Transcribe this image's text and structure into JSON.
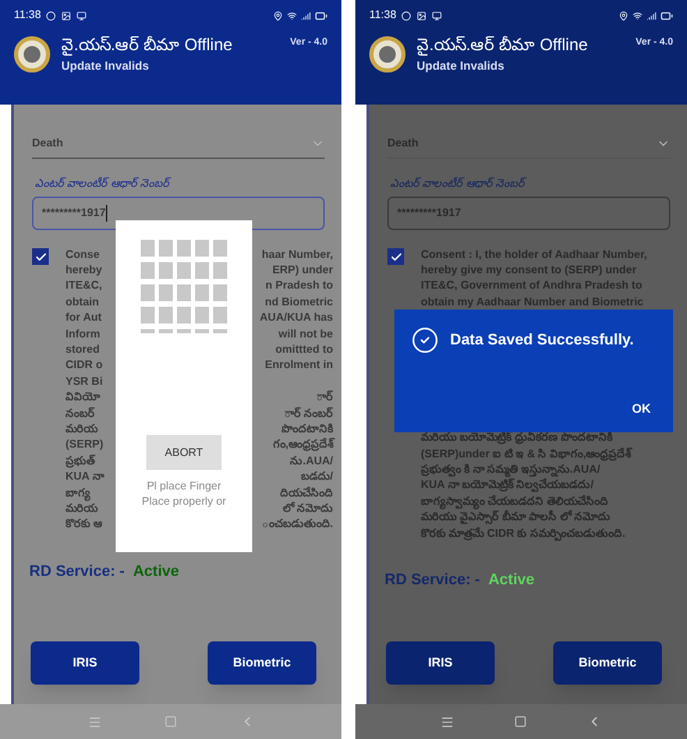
{
  "screens": [
    {
      "status_bar": {
        "time": "11:38"
      },
      "header": {
        "title": "వై.యస్.ఆర్ బీమా Offline",
        "subtitle": "Update Invalids",
        "version": "Ver - 4.0"
      },
      "reason": {
        "value": "Death"
      },
      "aadhaar": {
        "label": "ఎంటర్ వాలంటీర్ ఆధార్ నెంబర్",
        "value": "*********1917",
        "focused": true
      },
      "consent": {
        "checked": true,
        "lines": [
          {
            "left": "Conse",
            "right": "haar Number,"
          },
          {
            "left": "hereby",
            "right": "ERP) under"
          },
          {
            "left": "ITE&C,",
            "right": "n Pradesh to"
          },
          {
            "left": "obtain",
            "right": "nd Biometric"
          },
          {
            "left": "for Aut",
            "right": "AUA/KUA has"
          },
          {
            "left": "Inform",
            "right": "will not be"
          },
          {
            "left": "stored",
            "right": "omittted to"
          },
          {
            "left": "CIDR o",
            "right": "Enrolment in"
          },
          {
            "left": "YSR Bi"
          },
          {
            "left": "వివియో",
            "right": "ార్"
          },
          {
            "left": "నంబర్",
            "right": "ార్ నంబర్"
          },
          {
            "left": "మరియ",
            "right": "పొందటానికి"
          },
          {
            "left": "(SERP)",
            "right": "గం,ఆంధ్రప్రదేశ్"
          },
          {
            "left": "ప్రభుత్",
            "right": "ను.AUA/"
          },
          {
            "left": "KUA నా",
            "right": "బడదు/"
          },
          {
            "left": "బాగ్య",
            "right": "దియచేసింది"
          },
          {
            "left": "మరియ",
            "right": "లో నమోదు"
          },
          {
            "left": "కొరకు ఆ",
            "right": "ంచబడుతుంది."
          }
        ]
      },
      "rd_service": {
        "label": "RD Service: -",
        "status": "Active"
      },
      "buttons": [
        "IRIS",
        "Biometric"
      ],
      "dialog": {
        "kind": "fingerprint",
        "button": "ABORT",
        "message_lines": [
          "Pl place Finger",
          "Place properly or"
        ]
      }
    },
    {
      "status_bar": {
        "time": "11:38"
      },
      "header": {
        "title": "వై.యస్.ఆర్ బీమా Offline",
        "subtitle": "Update Invalids",
        "version": "Ver - 4.0"
      },
      "reason": {
        "value": "Death"
      },
      "aadhaar": {
        "label": "ఎంటర్ వాలంటీర్ ఆధార్ నెంబర్",
        "value": "*********1917",
        "focused": false
      },
      "consent": {
        "checked": true,
        "lines": [
          {
            "left": "Consent : I, the holder of Aadhaar Number,"
          },
          {
            "left": "hereby give my consent to (SERP) under"
          },
          {
            "left": "ITE&C, Government of Andhra Pradesh to"
          },
          {
            "left": "obtain my Aadhaar Number and Biometric"
          }
        ],
        "lines_below": [
          {
            "left": "మరియు బయోమెట్రిక్ ధ్రువీకరణ పొందటానికి"
          },
          {
            "left": "(SERP)under ఐ టి ఇ & సి విభాగం,ఆంధ్రప్రదేశ్"
          },
          {
            "left": "ప్రభుత్వం కి నా సమ్మతి ఇస్తున్నాను.AUA/"
          },
          {
            "left": "KUA నా బయోమెట్రిక్ నిల్వచేయబడదు/"
          },
          {
            "left": "బాగ్యస్వామ్యం చేయబడదని తెలియచేసింది"
          },
          {
            "left": "మరియు వైఎస్సార్ బీమా పాలసీ లో నమోదు"
          },
          {
            "left": "కొరకు మాత్రమే CIDR కు సమర్పించబడుతుంది."
          }
        ]
      },
      "rd_service": {
        "label": "RD Service: -",
        "status": "Active"
      },
      "buttons": [
        "IRIS",
        "Biometric"
      ],
      "dialog": {
        "kind": "alert",
        "message": "Data Saved Successfully.",
        "button": "OK"
      }
    }
  ]
}
